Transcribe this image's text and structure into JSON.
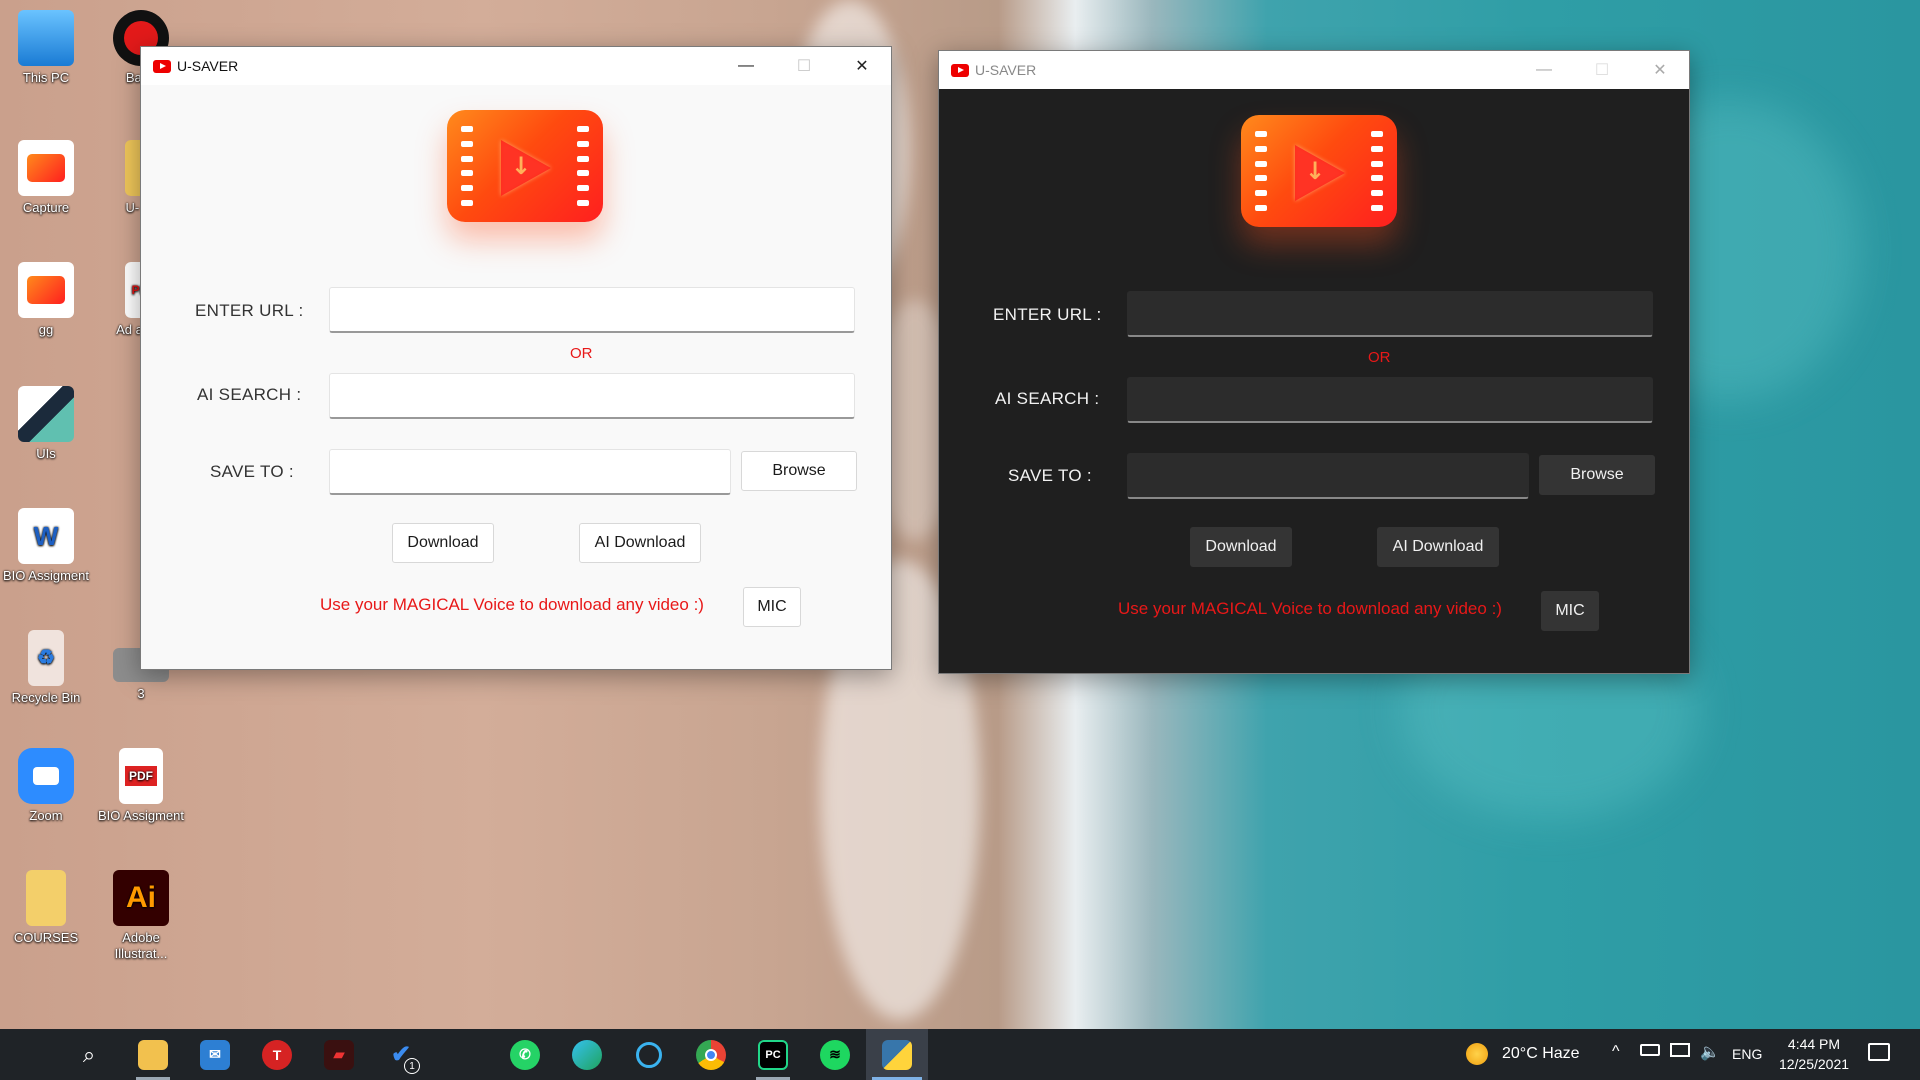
{
  "desktop": {
    "icons": [
      {
        "label": "This PC"
      },
      {
        "label": "Band"
      },
      {
        "label": "Capture"
      },
      {
        "label": "U- sa"
      },
      {
        "label": "gg"
      },
      {
        "label": "Ad assig"
      },
      {
        "label": "UIs"
      },
      {
        "label": "BIO Assigment"
      },
      {
        "label": "Recycle Bin"
      },
      {
        "label": "3"
      },
      {
        "label": "Zoom"
      },
      {
        "label": "BIO Assigment"
      },
      {
        "label": "COURSES"
      },
      {
        "label": "Adobe Illustrat..."
      }
    ]
  },
  "light_window": {
    "title": "U-SAVER",
    "enter_url_label": "ENTER URL :",
    "or_text": "OR",
    "ai_search_label": "AI SEARCH :",
    "save_to_label": "SAVE TO :",
    "browse_label": "Browse",
    "download_label": "Download",
    "ai_download_label": "AI Download",
    "voice_text": "Use your MAGICAL Voice to download any video :)",
    "mic_label": "MIC",
    "url_value": "",
    "search_value": "",
    "save_value": ""
  },
  "dark_window": {
    "title": "U-SAVER",
    "enter_url_label": "ENTER URL :",
    "or_text": "OR",
    "ai_search_label": "AI SEARCH :",
    "save_to_label": "SAVE TO :",
    "browse_label": "Browse",
    "download_label": "Download",
    "ai_download_label": "AI Download",
    "voice_text": "Use your MAGICAL Voice to download any video :)",
    "mic_label": "MIC",
    "url_value": "",
    "search_value": "",
    "save_value": ""
  },
  "taskbar": {
    "apps": [
      "start",
      "search",
      "file-explorer",
      "mail",
      "t-app",
      "racing-app",
      "todo",
      "office",
      "whatsapp",
      "edge",
      "cortana",
      "chrome",
      "pycharm",
      "spotify",
      "python"
    ],
    "todo_badge": "1",
    "weather": "20°C  Haze",
    "language": "ENG",
    "time": "4:44 PM",
    "date": "12/25/2021"
  },
  "colors": {
    "accent_red": "#e81818",
    "logo_orange": "#ff4b0f",
    "dark_bg": "#1f1f1f",
    "taskbar": "#1f2327"
  }
}
